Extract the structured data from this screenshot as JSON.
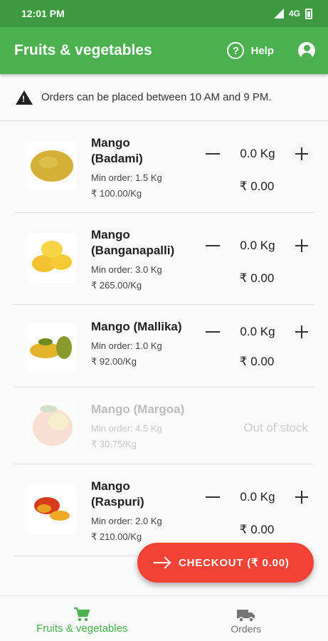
{
  "status_bar": {
    "time": "12:01 PM",
    "network": "4G"
  },
  "app_bar": {
    "title": "Fruits & vegetables",
    "help_label": "Help",
    "help_glyph": "?"
  },
  "notice": {
    "text": "Orders can be placed between 10 AM and 9 PM."
  },
  "products": [
    {
      "name_line1": "Mango",
      "name_line2": "(Badami)",
      "min_order": "Min order: 1.5 Kg",
      "price": "₹ 100.00/Kg",
      "quantity": "0.0 Kg",
      "total": "₹ 0.00",
      "in_stock": true
    },
    {
      "name_line1": "Mango",
      "name_line2": "(Banganapalli)",
      "min_order": "Min order: 3.0 Kg",
      "price": "₹ 265.00/Kg",
      "quantity": "0.0 Kg",
      "total": "₹ 0.00",
      "in_stock": true
    },
    {
      "name_line1": "Mango (Mallika)",
      "name_line2": "",
      "min_order": "Min order: 1.0 Kg",
      "price": "₹ 92.00/Kg",
      "quantity": "0.0 Kg",
      "total": "₹ 0.00",
      "in_stock": true
    },
    {
      "name_line1": "Mango (Margoa)",
      "name_line2": "",
      "min_order": "Min order: 4.5 Kg",
      "price": "₹ 30.75/Kg",
      "out_of_stock_label": "Out of stock",
      "in_stock": false
    },
    {
      "name_line1": "Mango",
      "name_line2": "(Raspuri)",
      "min_order": "Min order: 2.0 Kg",
      "price": "₹ 210.00/Kg",
      "quantity": "0.0 Kg",
      "total": "₹ 0.00",
      "in_stock": true
    }
  ],
  "checkout": {
    "label": "CHECKOUT (₹ 0.00)"
  },
  "bottom_nav": {
    "items": [
      {
        "label": "Fruits & vegetables",
        "active": true,
        "icon": "cart-icon"
      },
      {
        "label": "Orders",
        "active": false,
        "icon": "truck-icon"
      }
    ]
  },
  "colors": {
    "primary": "#4caf50",
    "status_bar": "#3d9a40",
    "checkout": "#f44336"
  }
}
